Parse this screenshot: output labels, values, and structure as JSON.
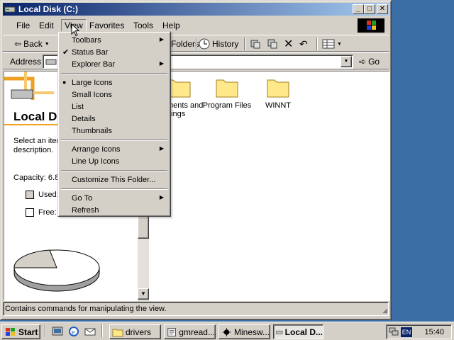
{
  "window": {
    "title": "Local Disk (C:)",
    "buttons": {
      "minimize": "_",
      "maximize": "□",
      "close": "✕"
    }
  },
  "menubar": {
    "items": [
      "File",
      "Edit",
      "View",
      "Favorites",
      "Tools",
      "Help"
    ]
  },
  "toolbar": {
    "back": "Back",
    "folders": "Folders",
    "history": "History"
  },
  "address": {
    "label": "Address",
    "go": "Go"
  },
  "view_menu": {
    "items": [
      {
        "label": "Toolbars",
        "submenu": true
      },
      {
        "label": "Status Bar",
        "checked": true
      },
      {
        "label": "Explorer Bar",
        "submenu": true
      },
      {
        "label": "Large Icons",
        "radio": true
      },
      {
        "label": "Small Icons"
      },
      {
        "label": "List"
      },
      {
        "label": "Details"
      },
      {
        "label": "Thumbnails"
      },
      {
        "label": "Arrange Icons",
        "submenu": true
      },
      {
        "label": "Line Up Icons"
      },
      {
        "label": "Customize This Folder..."
      },
      {
        "label": "Go To",
        "submenu": true
      },
      {
        "label": "Refresh"
      }
    ]
  },
  "left_pane": {
    "title": "Local Di",
    "description": "Select an item to view its description.",
    "capacity": "Capacity: 6.8",
    "used_label": "Used:",
    "free_label": "Free:",
    "used_color": "#d4d0c8",
    "free_color": "#ffffff"
  },
  "files": [
    {
      "name": "Documents and Settings",
      "visible_text": "ments and\nttings"
    },
    {
      "name": "Program Files",
      "visible_text": "Program Files"
    },
    {
      "name": "WINNT",
      "visible_text": "WINNT"
    }
  ],
  "statusbar": {
    "text": "Contains commands for manipulating the view."
  },
  "taskbar": {
    "start": "Start",
    "tasks": [
      {
        "label": "drivers"
      },
      {
        "label": "gmread..."
      },
      {
        "label": "Minesw..."
      },
      {
        "label": "Local D...",
        "active": true
      }
    ],
    "lang": "EN",
    "clock": "15:40"
  },
  "colors": {
    "desktop": "#3a6ea5",
    "titlebar_start": "#0a246a",
    "titlebar_end": "#a6caf0",
    "face": "#d4d0c8",
    "folder": "#ffe88a"
  }
}
